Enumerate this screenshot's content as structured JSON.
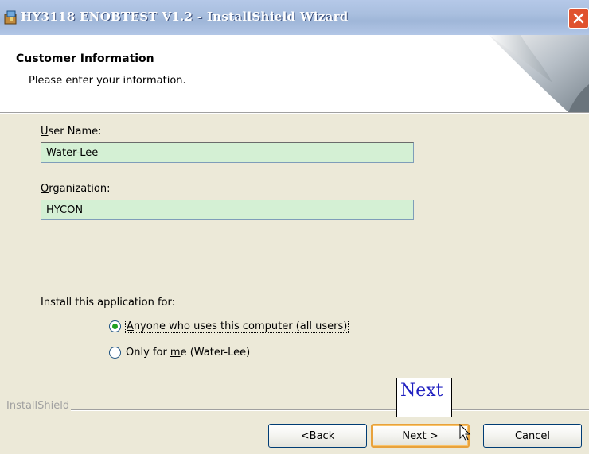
{
  "window": {
    "title": "HY3118 ENOBTEST V1.2 - InstallShield Wizard",
    "icons": {
      "app": "installer-icon",
      "close": "close-icon"
    }
  },
  "header": {
    "title": "Customer Information",
    "subtitle": "Please enter your information."
  },
  "form": {
    "user_name": {
      "label_mnemonic": "U",
      "label_rest": "ser Name:",
      "value": "Water-Lee"
    },
    "organization": {
      "label_mnemonic": "O",
      "label_rest": "rganization:",
      "value": "HYCON"
    },
    "install_for_label": "Install this application for:",
    "options": [
      {
        "mnemonic": "A",
        "rest": "nyone who uses this computer (all users)",
        "selected": true
      },
      {
        "prefix": "Only for ",
        "mnemonic": "m",
        "rest": "e (Water-Lee)",
        "selected": false
      }
    ]
  },
  "footer": {
    "brand": "InstallShield",
    "buttons": {
      "back": {
        "prefix": "< ",
        "mnemonic": "B",
        "rest": "ack"
      },
      "next": {
        "mnemonic": "N",
        "rest": "ext >"
      },
      "cancel": "Cancel"
    }
  },
  "annotation": {
    "text": "Next"
  },
  "colors": {
    "input_bg": "#D4F0D4",
    "title_bar": "#A9BFDF",
    "dialog_bg": "#ECE9D8",
    "default_button_border": "#E8A23C",
    "annotation_text": "#2020C0"
  }
}
